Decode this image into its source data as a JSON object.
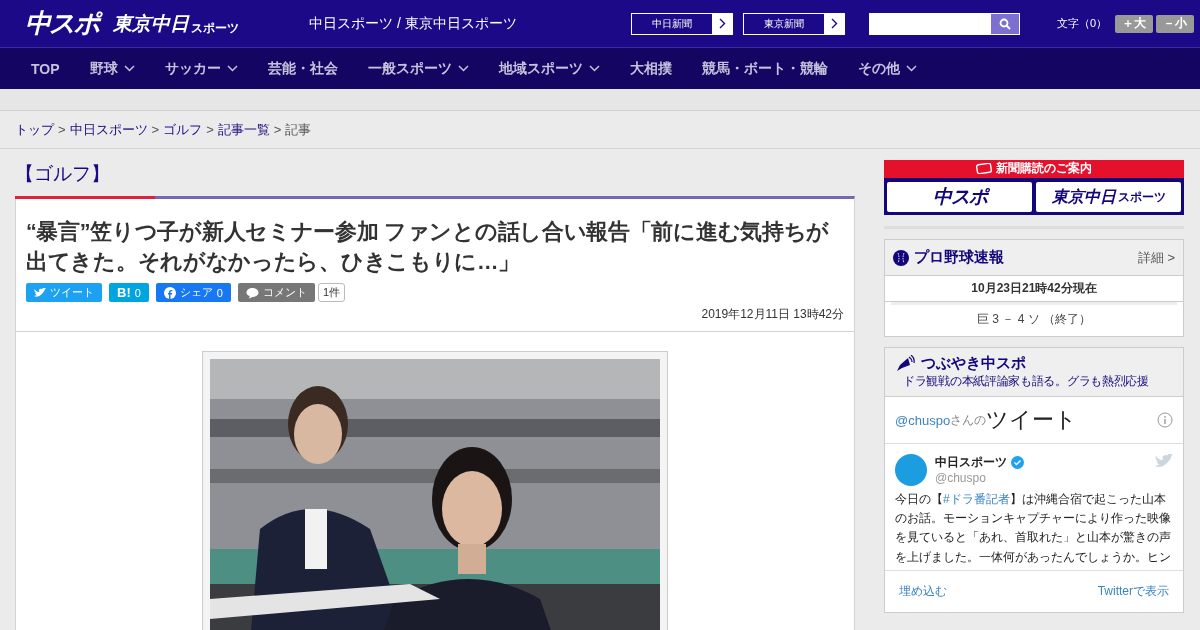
{
  "header": {
    "logo": "中スポ",
    "logo2": "東京中日",
    "logo2_sub": "スポーツ",
    "site_name": "中日スポーツ / 東京中日スポーツ",
    "paper_links": [
      "中日新聞",
      "東京新聞"
    ],
    "font_size": {
      "label": "文字（0）",
      "buttons": [
        "＋大",
        "－小"
      ]
    }
  },
  "nav": [
    {
      "label": "TOP",
      "has_menu": false
    },
    {
      "label": "野球",
      "has_menu": true
    },
    {
      "label": "サッカー",
      "has_menu": true
    },
    {
      "label": "芸能・社会",
      "has_menu": false
    },
    {
      "label": "一般スポーツ",
      "has_menu": true
    },
    {
      "label": "地域スポーツ",
      "has_menu": true
    },
    {
      "label": "大相撲",
      "has_menu": false
    },
    {
      "label": "競馬・ボート・競輪",
      "has_menu": false
    },
    {
      "label": "その他",
      "has_menu": true
    }
  ],
  "breadcrumb": {
    "links": [
      "トップ",
      "中日スポーツ",
      "ゴルフ",
      "記事一覧"
    ],
    "separator": ">",
    "current": "記事"
  },
  "article": {
    "category": "【ゴルフ】",
    "title": "“暴言”笠りつ子が新人セミナー参加 ファンとの話し合い報告「前に進む気持ちが出てきた。それがなかったら、ひきこもりに…」",
    "share": [
      {
        "kind": "twitter",
        "label": "ツイート"
      },
      {
        "kind": "hatena",
        "label": "B!",
        "count": "0"
      },
      {
        "kind": "facebook",
        "label": "シェア",
        "count": "0"
      },
      {
        "kind": "comment",
        "label": "コメント",
        "count": "1件"
      }
    ],
    "date": "2019年12月11日 13時42分"
  },
  "sidebar": {
    "subscribe": {
      "title": "新聞購読のご案内",
      "logos": [
        {
          "kind": "chuspo",
          "text": "中スポ"
        },
        {
          "kind": "tokyo",
          "text": "東京中日",
          "sub": "スポーツ"
        }
      ]
    },
    "baseball": {
      "title": "プロ野球速報",
      "more": "詳細 >",
      "time": "10月23日21時42分現在",
      "score": "巨 3 － 4 ソ （終了）"
    },
    "tweets": {
      "title": "つぶやき中スポ",
      "subtitle": "ドラ観戦の本紙評論家も語る。グラも熱烈応援",
      "handle": "@chuspo",
      "handle_suffix": "さんの",
      "heading": "ツイート",
      "author": "中日スポーツ",
      "verified": true,
      "author_handle": "@chuspo",
      "text_before": "今日の【",
      "hashtag": "#ドラ番記者",
      "text_after": "】は沖縄合宿で起こった山本のお話。モーションキャプチャーにより作った映像を見ていると「あれ、首取れた」と山本が驚きの声を上げました。一体何があったんでしょうか。ヒン",
      "embed": "埋め込む",
      "view": "Twitterで表示"
    }
  }
}
